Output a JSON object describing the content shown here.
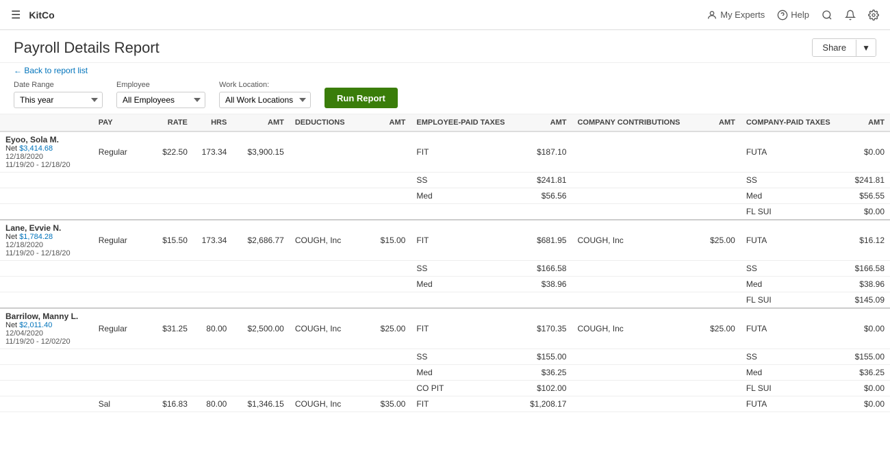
{
  "app": {
    "brand": "KitCo",
    "nav_items": [
      {
        "label": "My Experts",
        "icon": "person-icon"
      },
      {
        "label": "Help",
        "icon": "help-icon"
      },
      {
        "label": "",
        "icon": "search-icon"
      },
      {
        "label": "",
        "icon": "bell-icon"
      },
      {
        "label": "",
        "icon": "settings-icon"
      }
    ]
  },
  "page": {
    "title": "Payroll Details Report",
    "back_link": "← Back to report list",
    "share_label": "Share"
  },
  "filters": {
    "date_range_label": "Date Range",
    "date_range_value": "This year",
    "employee_label": "Employee",
    "employee_value": "All Employees",
    "work_location_label": "Work Location:",
    "work_location_value": "All Work Locations",
    "run_report_label": "Run Report"
  },
  "table": {
    "headers": {
      "pay": "PAY",
      "rate": "RATE",
      "hrs": "HRS",
      "amt": "AMT",
      "deductions": "DEDUCTIONS",
      "ded_amt": "AMT",
      "ep_taxes": "EMPLOYEE-PAID TAXES",
      "ep_amt": "AMT",
      "cc": "COMPANY CONTRIBUTIONS",
      "cc_amt": "AMT",
      "cp_taxes": "COMPANY-PAID TAXES",
      "cp_amt": "AMT"
    },
    "employees": [
      {
        "name": "Eyoo, Sola M.",
        "net_label": "Net",
        "net_amount": "$3,414.68",
        "date": "12/18/2020",
        "range": "11/19/20 - 12/18/20",
        "rows": [
          {
            "pay": "Regular",
            "rate": "$22.50",
            "hrs": "173.34",
            "amt": "$3,900.15",
            "deduction": "",
            "ded_amt": "",
            "ep_tax": "FIT",
            "ep_amt": "$187.10",
            "cc": "",
            "cc_amt": "",
            "cp_tax": "FUTA",
            "cp_amt": "$0.00"
          },
          {
            "pay": "",
            "rate": "",
            "hrs": "",
            "amt": "",
            "deduction": "",
            "ded_amt": "",
            "ep_tax": "SS",
            "ep_amt": "$241.81",
            "cc": "",
            "cc_amt": "",
            "cp_tax": "SS",
            "cp_amt": "$241.81"
          },
          {
            "pay": "",
            "rate": "",
            "hrs": "",
            "amt": "",
            "deduction": "",
            "ded_amt": "",
            "ep_tax": "Med",
            "ep_amt": "$56.56",
            "cc": "",
            "cc_amt": "",
            "cp_tax": "Med",
            "cp_amt": "$56.55"
          },
          {
            "pay": "",
            "rate": "",
            "hrs": "",
            "amt": "",
            "deduction": "",
            "ded_amt": "",
            "ep_tax": "",
            "ep_amt": "",
            "cc": "",
            "cc_amt": "",
            "cp_tax": "FL SUI",
            "cp_amt": "$0.00"
          }
        ]
      },
      {
        "name": "Lane, Evvie N.",
        "net_label": "Net",
        "net_amount": "$1,784.28",
        "date": "12/18/2020",
        "range": "11/19/20 - 12/18/20",
        "rows": [
          {
            "pay": "Regular",
            "rate": "$15.50",
            "hrs": "173.34",
            "amt": "$2,686.77",
            "deduction": "COUGH, Inc",
            "ded_amt": "$15.00",
            "ep_tax": "FIT",
            "ep_amt": "$681.95",
            "cc": "COUGH, Inc",
            "cc_amt": "$25.00",
            "cp_tax": "FUTA",
            "cp_amt": "$16.12"
          },
          {
            "pay": "",
            "rate": "",
            "hrs": "",
            "amt": "",
            "deduction": "",
            "ded_amt": "",
            "ep_tax": "SS",
            "ep_amt": "$166.58",
            "cc": "",
            "cc_amt": "",
            "cp_tax": "SS",
            "cp_amt": "$166.58"
          },
          {
            "pay": "",
            "rate": "",
            "hrs": "",
            "amt": "",
            "deduction": "",
            "ded_amt": "",
            "ep_tax": "Med",
            "ep_amt": "$38.96",
            "cc": "",
            "cc_amt": "",
            "cp_tax": "Med",
            "cp_amt": "$38.96"
          },
          {
            "pay": "",
            "rate": "",
            "hrs": "",
            "amt": "",
            "deduction": "",
            "ded_amt": "",
            "ep_tax": "",
            "ep_amt": "",
            "cc": "",
            "cc_amt": "",
            "cp_tax": "FL SUI",
            "cp_amt": "$145.09"
          }
        ]
      },
      {
        "name": "Barrilow, Manny L.",
        "net_label": "Net",
        "net_amount": "$2,011.40",
        "date": "12/04/2020",
        "range": "11/19/20 - 12/02/20",
        "rows": [
          {
            "pay": "Regular",
            "rate": "$31.25",
            "hrs": "80.00",
            "amt": "$2,500.00",
            "deduction": "COUGH, Inc",
            "ded_amt": "$25.00",
            "ep_tax": "FIT",
            "ep_amt": "$170.35",
            "cc": "COUGH, Inc",
            "cc_amt": "$25.00",
            "cp_tax": "FUTA",
            "cp_amt": "$0.00"
          },
          {
            "pay": "",
            "rate": "",
            "hrs": "",
            "amt": "",
            "deduction": "",
            "ded_amt": "",
            "ep_tax": "SS",
            "ep_amt": "$155.00",
            "cc": "",
            "cc_amt": "",
            "cp_tax": "SS",
            "cp_amt": "$155.00"
          },
          {
            "pay": "",
            "rate": "",
            "hrs": "",
            "amt": "",
            "deduction": "",
            "ded_amt": "",
            "ep_tax": "Med",
            "ep_amt": "$36.25",
            "cc": "",
            "cc_amt": "",
            "cp_tax": "Med",
            "cp_amt": "$36.25"
          },
          {
            "pay": "",
            "rate": "",
            "hrs": "",
            "amt": "",
            "deduction": "",
            "ded_amt": "",
            "ep_tax": "CO PIT",
            "ep_amt": "$102.00",
            "cc": "",
            "cc_amt": "",
            "cp_tax": "FL SUI",
            "cp_amt": "$0.00"
          },
          {
            "pay": "Sal",
            "rate": "$16.83",
            "hrs": "80.00",
            "amt": "$1,346.15",
            "deduction": "COUGH, Inc",
            "ded_amt": "$35.00",
            "ep_tax": "FIT",
            "ep_amt": "$1,208.17",
            "cc": "",
            "cc_amt": "",
            "cp_tax": "FUTA",
            "cp_amt": "$0.00"
          }
        ]
      }
    ]
  }
}
